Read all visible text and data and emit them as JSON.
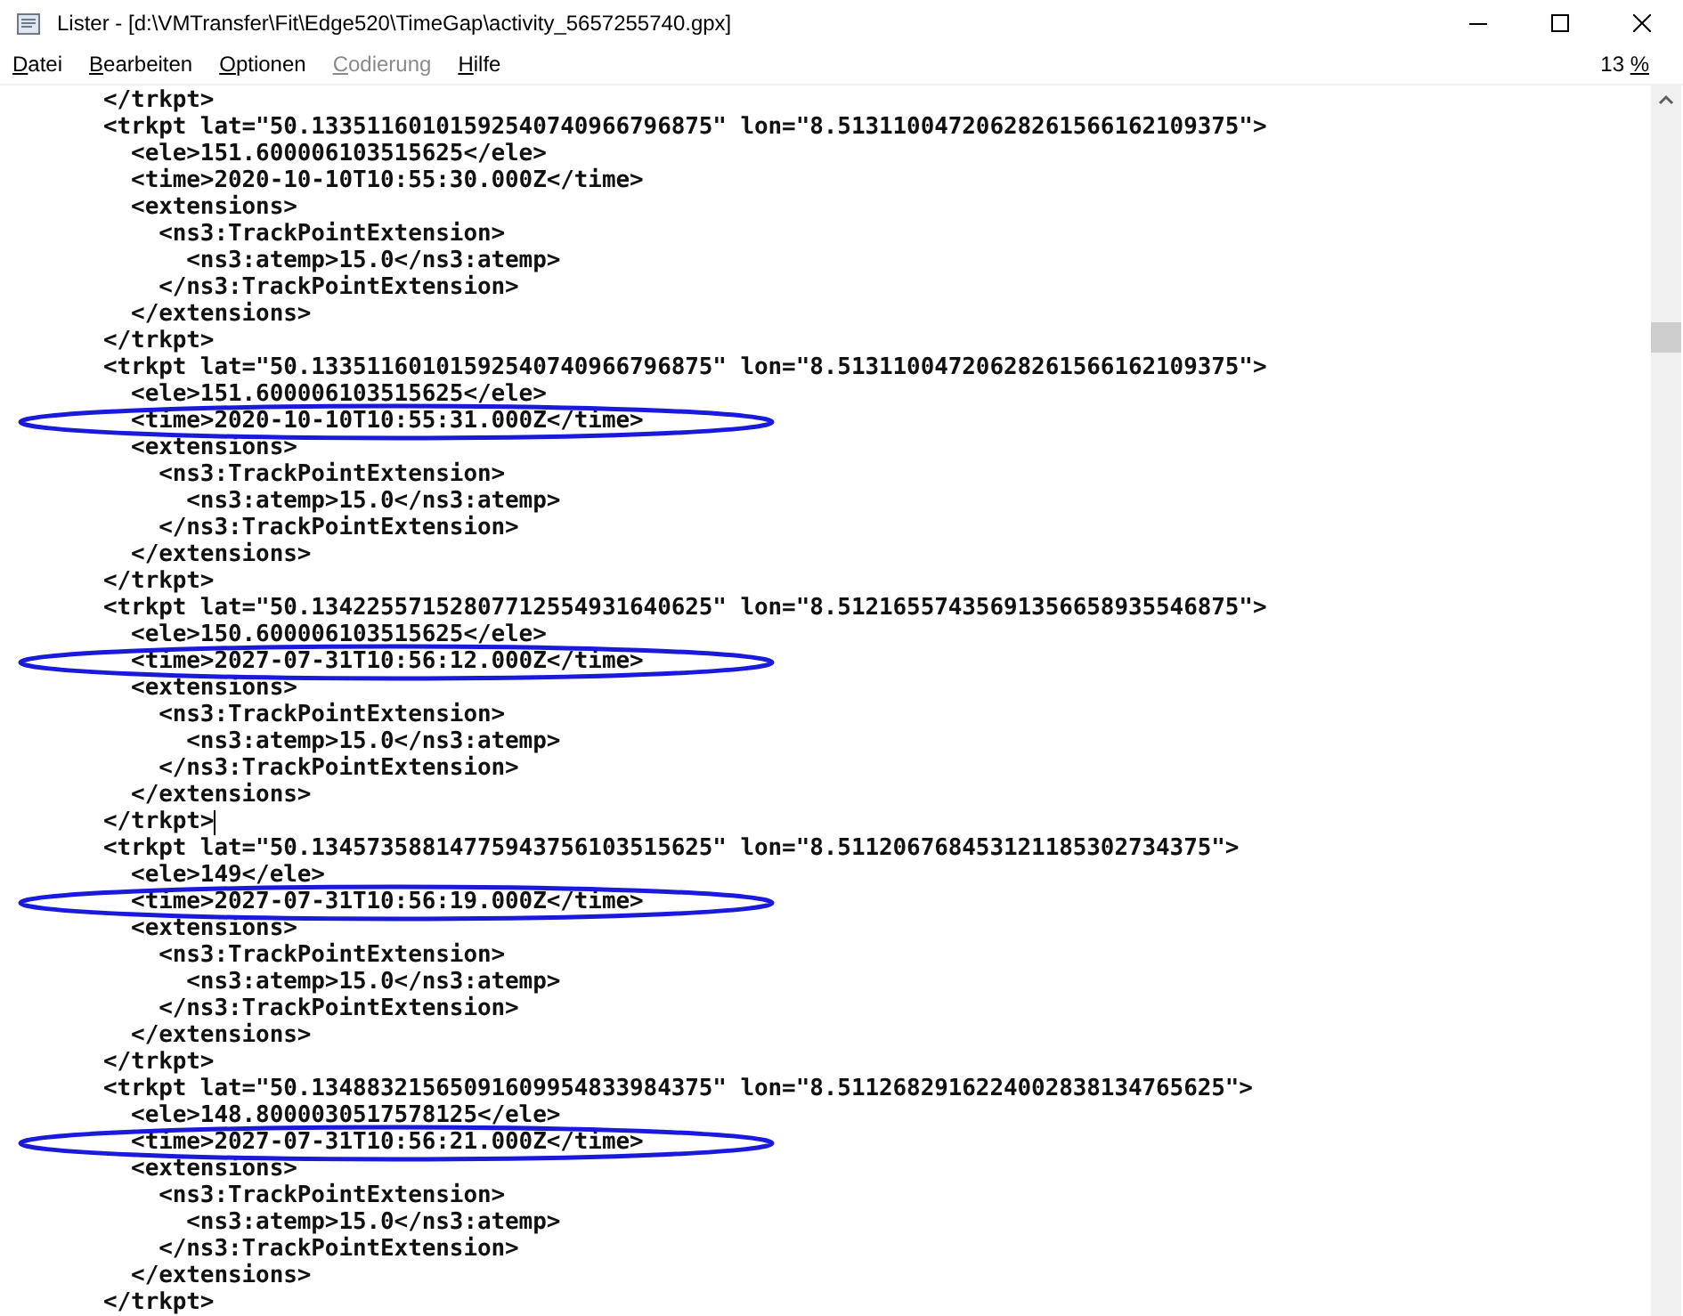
{
  "window": {
    "title": "Lister - [d:\\VMTransfer\\Fit\\Edge520\\TimeGap\\activity_5657255740.gpx]"
  },
  "menu": [
    {
      "label": "Datei",
      "disabled": false
    },
    {
      "label": "Bearbeiten",
      "disabled": false
    },
    {
      "label": "Optionen",
      "disabled": false
    },
    {
      "label": "Codierung",
      "disabled": true
    },
    {
      "label": "Hilfe",
      "disabled": false
    }
  ],
  "position": {
    "value": "13",
    "unit": "%"
  },
  "lines": [
    {
      "text": "</trkpt>",
      "circled": false,
      "cursor": false
    },
    {
      "text": "<trkpt lat=\"50.13351160101592540740966796875\" lon=\"8.51311004720628261566162109375\">",
      "circled": false,
      "cursor": false
    },
    {
      "text": "  <ele>151.600006103515625</ele>",
      "circled": false,
      "cursor": false
    },
    {
      "text": "  <time>2020-10-10T10:55:30.000Z</time>",
      "circled": false,
      "cursor": false
    },
    {
      "text": "  <extensions>",
      "circled": false,
      "cursor": false
    },
    {
      "text": "    <ns3:TrackPointExtension>",
      "circled": false,
      "cursor": false
    },
    {
      "text": "      <ns3:atemp>15.0</ns3:atemp>",
      "circled": false,
      "cursor": false
    },
    {
      "text": "    </ns3:TrackPointExtension>",
      "circled": false,
      "cursor": false
    },
    {
      "text": "  </extensions>",
      "circled": false,
      "cursor": false
    },
    {
      "text": "</trkpt>",
      "circled": false,
      "cursor": false
    },
    {
      "text": "<trkpt lat=\"50.13351160101592540740966796875\" lon=\"8.51311004720628261566162109375\">",
      "circled": false,
      "cursor": false
    },
    {
      "text": "  <ele>151.600006103515625</ele>",
      "circled": false,
      "cursor": false
    },
    {
      "text": "  <time>2020-10-10T10:55:31.000Z</time>",
      "circled": true,
      "cursor": false
    },
    {
      "text": "  <extensions>",
      "circled": false,
      "cursor": false
    },
    {
      "text": "    <ns3:TrackPointExtension>",
      "circled": false,
      "cursor": false
    },
    {
      "text": "      <ns3:atemp>15.0</ns3:atemp>",
      "circled": false,
      "cursor": false
    },
    {
      "text": "    </ns3:TrackPointExtension>",
      "circled": false,
      "cursor": false
    },
    {
      "text": "  </extensions>",
      "circled": false,
      "cursor": false
    },
    {
      "text": "</trkpt>",
      "circled": false,
      "cursor": false
    },
    {
      "text": "<trkpt lat=\"50.13422557152807712554931640625\" lon=\"8.51216557435691356658935546875\">",
      "circled": false,
      "cursor": false
    },
    {
      "text": "  <ele>150.600006103515625</ele>",
      "circled": false,
      "cursor": false
    },
    {
      "text": "  <time>2027-07-31T10:56:12.000Z</time>",
      "circled": true,
      "cursor": false
    },
    {
      "text": "  <extensions>",
      "circled": false,
      "cursor": false
    },
    {
      "text": "    <ns3:TrackPointExtension>",
      "circled": false,
      "cursor": false
    },
    {
      "text": "      <ns3:atemp>15.0</ns3:atemp>",
      "circled": false,
      "cursor": false
    },
    {
      "text": "    </ns3:TrackPointExtension>",
      "circled": false,
      "cursor": false
    },
    {
      "text": "  </extensions>",
      "circled": false,
      "cursor": false
    },
    {
      "text": "</trkpt>",
      "circled": false,
      "cursor": true
    },
    {
      "text": "<trkpt lat=\"50.13457358814775943756103515625\" lon=\"8.511206768453121185302734375\">",
      "circled": false,
      "cursor": false
    },
    {
      "text": "  <ele>149</ele>",
      "circled": false,
      "cursor": false
    },
    {
      "text": "  <time>2027-07-31T10:56:19.000Z</time>",
      "circled": true,
      "cursor": false
    },
    {
      "text": "  <extensions>",
      "circled": false,
      "cursor": false
    },
    {
      "text": "    <ns3:TrackPointExtension>",
      "circled": false,
      "cursor": false
    },
    {
      "text": "      <ns3:atemp>15.0</ns3:atemp>",
      "circled": false,
      "cursor": false
    },
    {
      "text": "    </ns3:TrackPointExtension>",
      "circled": false,
      "cursor": false
    },
    {
      "text": "  </extensions>",
      "circled": false,
      "cursor": false
    },
    {
      "text": "</trkpt>",
      "circled": false,
      "cursor": false
    },
    {
      "text": "<trkpt lat=\"50.13488321565091609954833984375\" lon=\"8.5112682916224002838134765625\">",
      "circled": false,
      "cursor": false
    },
    {
      "text": "  <ele>148.8000030517578125</ele>",
      "circled": false,
      "cursor": false
    },
    {
      "text": "  <time>2027-07-31T10:56:21.000Z</time>",
      "circled": true,
      "cursor": false
    },
    {
      "text": "  <extensions>",
      "circled": false,
      "cursor": false
    },
    {
      "text": "    <ns3:TrackPointExtension>",
      "circled": false,
      "cursor": false
    },
    {
      "text": "      <ns3:atemp>15.0</ns3:atemp>",
      "circled": false,
      "cursor": false
    },
    {
      "text": "    </ns3:TrackPointExtension>",
      "circled": false,
      "cursor": false
    },
    {
      "text": "  </extensions>",
      "circled": false,
      "cursor": false
    },
    {
      "text": "</trkpt>",
      "circled": false,
      "cursor": false
    }
  ]
}
